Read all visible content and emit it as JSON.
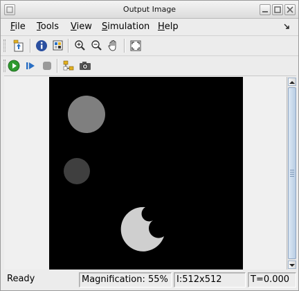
{
  "window": {
    "title": "Output Image"
  },
  "menubar": {
    "items": [
      {
        "label": "File",
        "mnemonic": "F",
        "rest": "ile"
      },
      {
        "label": "Tools",
        "mnemonic": "T",
        "rest": "ools"
      },
      {
        "label": "View",
        "mnemonic": "V",
        "rest": "iew"
      },
      {
        "label": "Simulation",
        "mnemonic": "S",
        "rest": "imulation"
      },
      {
        "label": "Help",
        "mnemonic": "H",
        "rest": "elp"
      }
    ]
  },
  "toolbar1": {
    "icons": [
      "export-to-workspace-icon",
      "info-icon",
      "pixel-region-icon",
      "zoom-in-icon",
      "zoom-out-icon",
      "pan-hand-icon",
      "fit-to-window-icon"
    ]
  },
  "toolbar2": {
    "icons": [
      "play-icon",
      "step-forward-icon",
      "stop-icon",
      "highlight-model-icon",
      "snapshot-camera-icon"
    ]
  },
  "image": {
    "background": "#000000",
    "blob_colors": [
      "#7f7f7f",
      "#3f3f3f",
      "#cfcfcf"
    ]
  },
  "statusbar": {
    "state": "Ready",
    "magnification": "Magnification: 55%",
    "intensity_size": "I:512x512",
    "time": "T=0.000"
  },
  "colors": {
    "play_green": "#2e9a2e",
    "step_blue": "#2a6fc4",
    "stop_grey": "#9a9a9a",
    "scroll_blue": "#b9cde3"
  }
}
